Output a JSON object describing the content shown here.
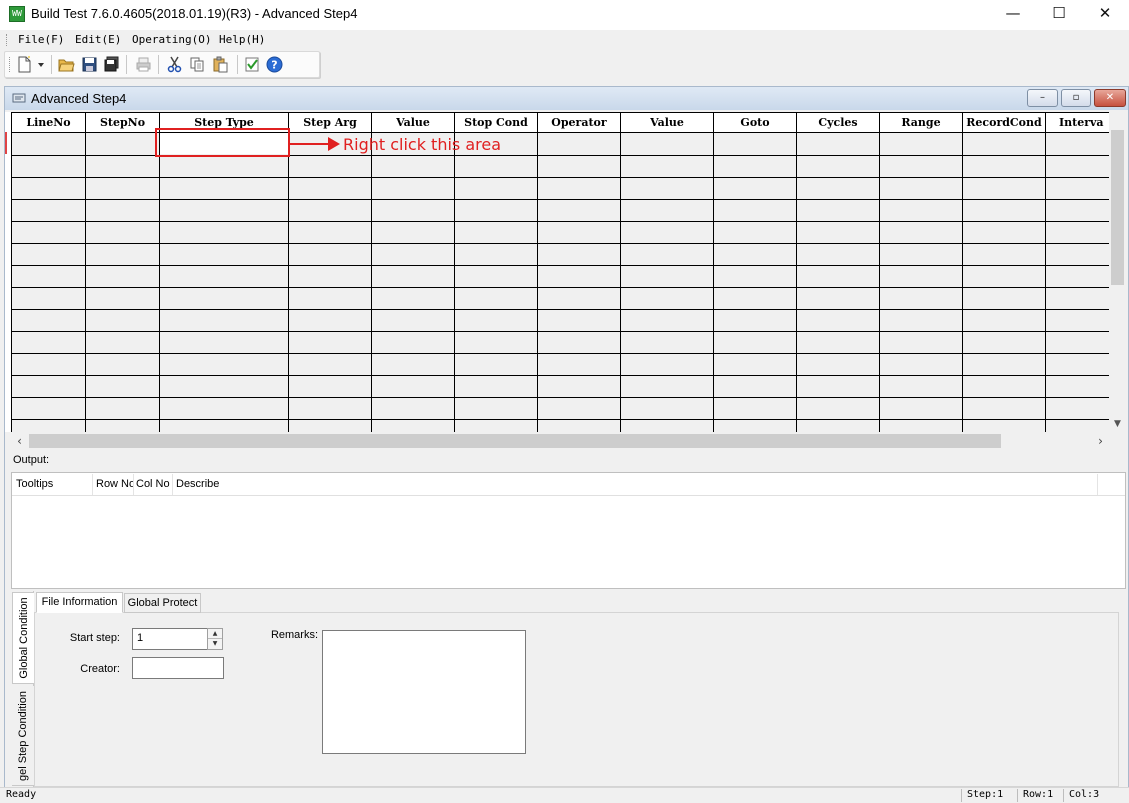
{
  "window": {
    "app_icon_text": "WW",
    "title": "Build Test  7.6.0.4605(2018.01.19)(R3) - Advanced Step4",
    "minimize": "—",
    "maximize": "☐",
    "close": "✕"
  },
  "menu": [
    "File(F)",
    "Edit(E)",
    "Operating(O)",
    "Help(H)"
  ],
  "toolbar": {
    "icons": [
      "new-file-icon",
      "dropdown-arrow-icon",
      "open-folder-icon",
      "save-icon",
      "save-all-icon",
      "print-icon",
      "cut-icon",
      "copy-icon",
      "paste-icon",
      "check-icon",
      "help-icon"
    ]
  },
  "child_window": {
    "title": "Advanced Step4",
    "minimize": "–",
    "restore": "▫",
    "close": "✕"
  },
  "grid": {
    "columns": [
      "LineNo",
      "StepNo",
      "Step Type",
      "Step Arg",
      "Value",
      "Stop Cond",
      "Operator",
      "Value",
      "Goto",
      "Cycles",
      "Range",
      "RecordCond",
      "Interva"
    ],
    "row_count": 14
  },
  "annotation": {
    "text": "Right click this area",
    "color": "#e02020"
  },
  "output": {
    "label": "Output:",
    "columns": [
      "Tooltips",
      "Row No",
      "Col No",
      "Describe"
    ]
  },
  "bottom_panel": {
    "vertical_tabs": [
      "Global Condition",
      "gel Step Condition"
    ],
    "tabs": [
      "File Information",
      "Global Protect"
    ],
    "start_step_label": "Start step:",
    "start_step_value": "1",
    "creator_label": "Creator:",
    "creator_value": "",
    "remarks_label": "Remarks:",
    "remarks_value": ""
  },
  "status": {
    "ready": "Ready",
    "step": "Step:1",
    "row": "Row:1",
    "col": "Col:3"
  }
}
